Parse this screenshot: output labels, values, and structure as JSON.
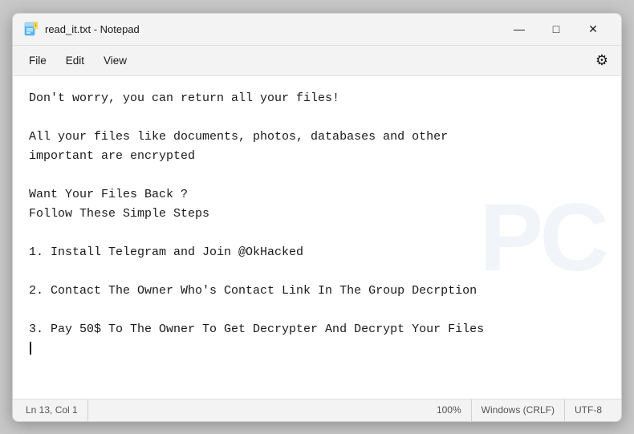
{
  "window": {
    "title": "read_it.txt - Notepad",
    "icon_label": "notepad-icon"
  },
  "title_controls": {
    "minimize": "—",
    "maximize": "□",
    "close": "✕"
  },
  "menu": {
    "items": [
      "File",
      "Edit",
      "View"
    ],
    "settings_icon": "⚙"
  },
  "content": {
    "text": "Don't worry, you can return all your files!\n\nAll your files like documents, photos, databases and other\nimportant are encrypted\n\nWant Your Files Back ?\nFollow These Simple Steps\n\n1. Install Telegram and Join @OkHacked\n\n2. Contact The Owner Who's Contact Link In The Group Decrption\n\n3. Pay 50$ To The Owner To Get Decrypter And Decrypt Your Files\n"
  },
  "watermark": {
    "text": "PC"
  },
  "status_bar": {
    "position": "Ln 13, Col 1",
    "zoom": "100%",
    "line_ending": "Windows (CRLF)",
    "encoding": "UTF-8"
  }
}
